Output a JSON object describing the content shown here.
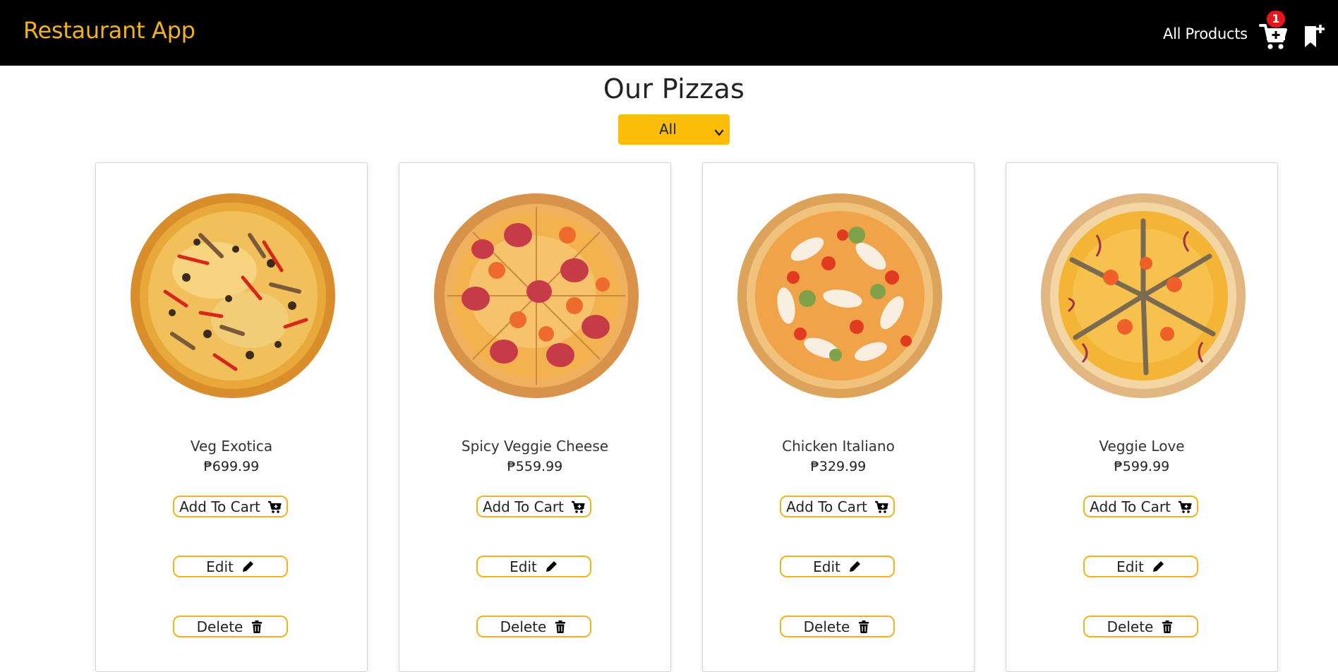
{
  "navbar": {
    "brand": "Restaurant App",
    "all_products": "All Products",
    "cart_count": "1",
    "cart_icon": "cart-plus-icon",
    "bookmark_icon": "bookmark-plus-icon",
    "brand_color": "#f2b21d"
  },
  "header": {
    "title": "Our Pizzas",
    "filter_value": "All"
  },
  "products": [
    {
      "name": "Veg Exotica",
      "price": "₱699.99",
      "cart_label": "Add To Cart",
      "edit_label": "Edit",
      "delete_label": "Delete"
    },
    {
      "name": "Spicy Veggie Cheese",
      "price": "₱559.99",
      "cart_label": "Add To Cart",
      "edit_label": "Edit",
      "delete_label": "Delete"
    },
    {
      "name": "Chicken Italiano",
      "price": "₱329.99",
      "cart_label": "Add To Cart",
      "edit_label": "Edit",
      "delete_label": "Delete"
    },
    {
      "name": "Veggie Love",
      "price": "₱599.99",
      "cart_label": "Add To Cart",
      "edit_label": "Edit",
      "delete_label": "Delete"
    }
  ],
  "colors": {
    "accent": "#fbbd08",
    "badge": "#e8161b",
    "navbar_bg": "#000000"
  }
}
